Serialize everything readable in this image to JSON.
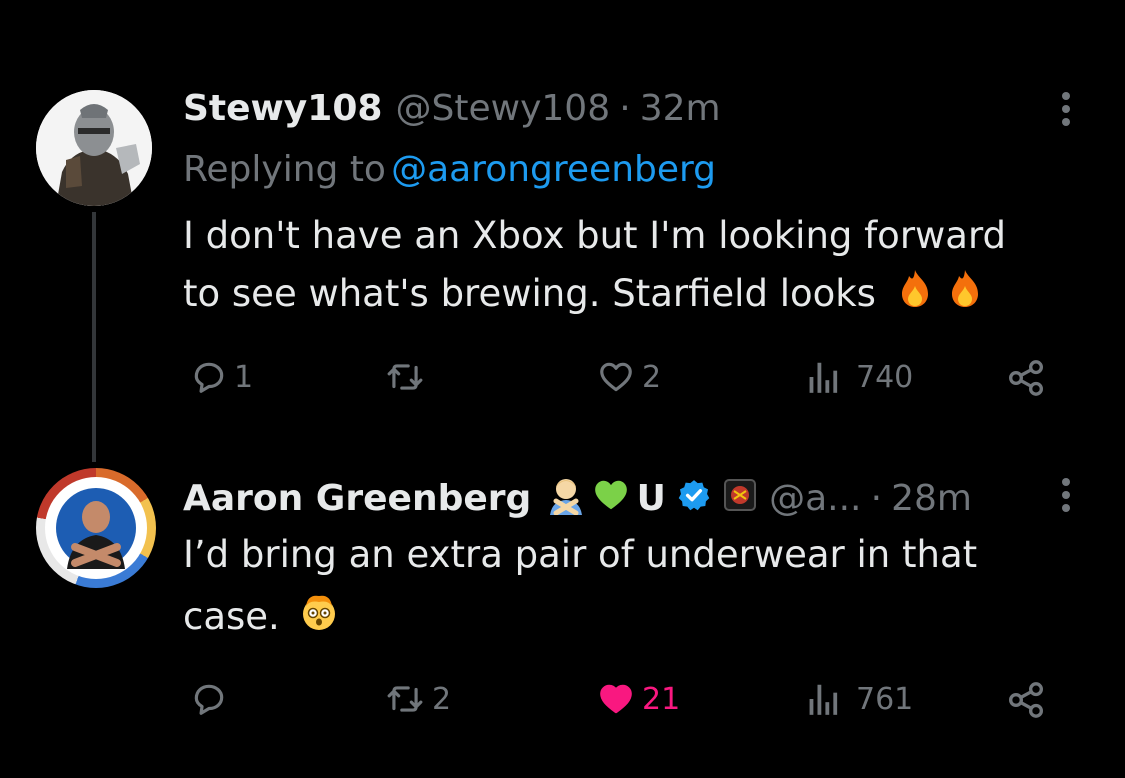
{
  "tweet1": {
    "display_name": "Stewy108",
    "handle": "@Stewy108",
    "separator": "·",
    "time": "32m",
    "replying_prefix": "Replying to",
    "replying_to": "@aarongreenberg",
    "text_line1": "I don't have an Xbox but I'm looking forward",
    "text_line2": "to see what's brewing. Starfield looks",
    "emoji": [
      "fire-emoji",
      "fire-emoji"
    ],
    "replies": "1",
    "retweets": "",
    "likes": "2",
    "views": "740"
  },
  "tweet2": {
    "display_name": "Aaron Greenberg",
    "name_suffix_letter": "U",
    "name_emoji": [
      "person-gesturing-no-emoji",
      "green-heart-emoji"
    ],
    "verified_color": "#1d9bf0",
    "handle": "@a...",
    "separator": "·",
    "time": "28m",
    "text_line1": "I’d bring an extra pair of underwear in that",
    "text_line2": "case.",
    "emoji": [
      "exploding-head-emoji"
    ],
    "replies": "",
    "retweets": "2",
    "likes": "21",
    "liked": true,
    "like_color": "#f91880",
    "views": "761"
  },
  "colors": {
    "background": "#000000",
    "text": "#e7e9ea",
    "muted": "#71767b",
    "link": "#1d9bf0"
  }
}
